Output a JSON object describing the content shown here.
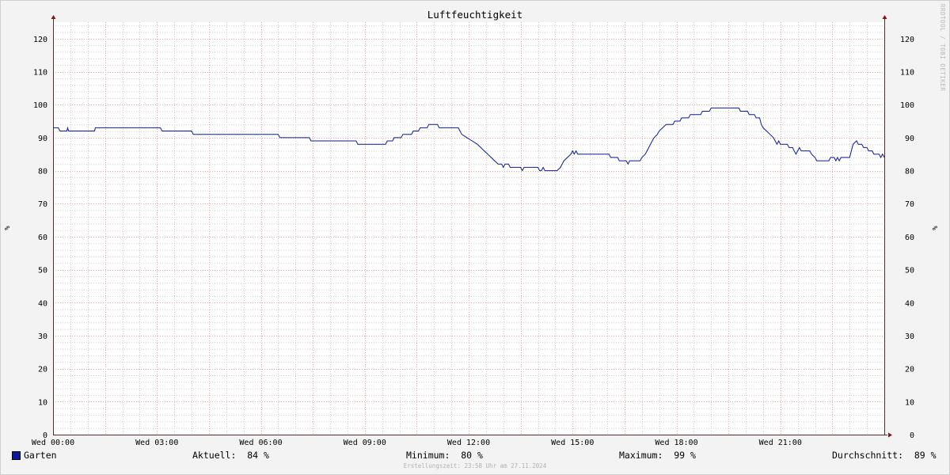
{
  "chart_data": {
    "type": "line",
    "title": "Luftfeuchtigkeit",
    "ylabel": "%",
    "ylim": [
      0,
      125
    ],
    "y_major_ticks": [
      0,
      10,
      20,
      30,
      40,
      50,
      60,
      70,
      80,
      90,
      100,
      110,
      120
    ],
    "x_range_hours": [
      0,
      24
    ],
    "x_tick_labels": [
      "Wed 00:00",
      "Wed 03:00",
      "Wed 06:00",
      "Wed 09:00",
      "Wed 12:00",
      "Wed 15:00",
      "Wed 18:00",
      "Wed 21:00"
    ],
    "grid": true,
    "series": [
      {
        "name": "Garten",
        "color": "#0a1a9a",
        "points": [
          [
            0.0,
            93
          ],
          [
            0.15,
            93
          ],
          [
            0.2,
            92
          ],
          [
            0.4,
            92
          ],
          [
            0.42,
            93
          ],
          [
            0.45,
            92
          ],
          [
            1.2,
            92
          ],
          [
            1.22,
            93
          ],
          [
            3.1,
            93
          ],
          [
            3.15,
            92
          ],
          [
            4.0,
            92
          ],
          [
            4.05,
            91
          ],
          [
            6.5,
            91
          ],
          [
            6.55,
            90
          ],
          [
            7.4,
            90
          ],
          [
            7.45,
            89
          ],
          [
            8.75,
            89
          ],
          [
            8.8,
            88
          ],
          [
            9.6,
            88
          ],
          [
            9.65,
            89
          ],
          [
            9.8,
            89
          ],
          [
            9.85,
            90
          ],
          [
            10.05,
            90
          ],
          [
            10.1,
            91
          ],
          [
            10.35,
            91
          ],
          [
            10.4,
            92
          ],
          [
            10.55,
            92
          ],
          [
            10.6,
            93
          ],
          [
            10.8,
            93
          ],
          [
            10.85,
            94
          ],
          [
            11.1,
            94
          ],
          [
            11.15,
            93
          ],
          [
            11.7,
            93
          ],
          [
            11.75,
            92
          ],
          [
            11.8,
            91
          ],
          [
            11.95,
            90
          ],
          [
            12.1,
            89
          ],
          [
            12.25,
            88
          ],
          [
            12.35,
            87
          ],
          [
            12.45,
            86
          ],
          [
            12.55,
            85
          ],
          [
            12.65,
            84
          ],
          [
            12.75,
            83
          ],
          [
            12.85,
            82
          ],
          [
            12.95,
            82
          ],
          [
            13.0,
            81
          ],
          [
            13.05,
            82
          ],
          [
            13.15,
            82
          ],
          [
            13.2,
            81
          ],
          [
            13.5,
            81
          ],
          [
            13.55,
            80
          ],
          [
            13.6,
            81
          ],
          [
            14.0,
            81
          ],
          [
            14.05,
            80
          ],
          [
            14.1,
            80
          ],
          [
            14.15,
            81
          ],
          [
            14.2,
            80
          ],
          [
            14.55,
            80
          ],
          [
            14.65,
            81
          ],
          [
            14.75,
            83
          ],
          [
            14.85,
            84
          ],
          [
            14.95,
            85
          ],
          [
            15.0,
            86
          ],
          [
            15.05,
            85
          ],
          [
            15.1,
            86
          ],
          [
            15.15,
            85
          ],
          [
            16.05,
            85
          ],
          [
            16.1,
            84
          ],
          [
            16.3,
            84
          ],
          [
            16.35,
            83
          ],
          [
            16.55,
            83
          ],
          [
            16.6,
            82
          ],
          [
            16.65,
            83
          ],
          [
            16.95,
            83
          ],
          [
            17.0,
            84
          ],
          [
            17.1,
            85
          ],
          [
            17.15,
            86
          ],
          [
            17.2,
            87
          ],
          [
            17.25,
            88
          ],
          [
            17.3,
            89
          ],
          [
            17.35,
            90
          ],
          [
            17.45,
            91
          ],
          [
            17.5,
            92
          ],
          [
            17.6,
            93
          ],
          [
            17.7,
            94
          ],
          [
            17.9,
            94
          ],
          [
            17.95,
            95
          ],
          [
            18.1,
            95
          ],
          [
            18.15,
            96
          ],
          [
            18.35,
            96
          ],
          [
            18.4,
            97
          ],
          [
            18.7,
            97
          ],
          [
            18.75,
            98
          ],
          [
            18.95,
            98
          ],
          [
            19.0,
            99
          ],
          [
            19.8,
            99
          ],
          [
            19.85,
            98
          ],
          [
            20.05,
            98
          ],
          [
            20.1,
            97
          ],
          [
            20.25,
            97
          ],
          [
            20.3,
            96
          ],
          [
            20.4,
            96
          ],
          [
            20.45,
            94
          ],
          [
            20.5,
            93
          ],
          [
            20.6,
            92
          ],
          [
            20.7,
            91
          ],
          [
            20.8,
            90
          ],
          [
            20.85,
            89
          ],
          [
            20.9,
            88
          ],
          [
            20.95,
            89
          ],
          [
            21.0,
            88
          ],
          [
            21.2,
            88
          ],
          [
            21.25,
            87
          ],
          [
            21.35,
            87
          ],
          [
            21.4,
            86
          ],
          [
            21.45,
            85
          ],
          [
            21.5,
            86
          ],
          [
            21.55,
            87
          ],
          [
            21.6,
            86
          ],
          [
            21.85,
            86
          ],
          [
            21.9,
            85
          ],
          [
            22.0,
            84
          ],
          [
            22.05,
            83
          ],
          [
            22.4,
            83
          ],
          [
            22.45,
            84
          ],
          [
            22.55,
            84
          ],
          [
            22.6,
            83
          ],
          [
            22.65,
            84
          ],
          [
            22.7,
            83
          ],
          [
            22.75,
            84
          ],
          [
            23.0,
            84
          ],
          [
            23.05,
            86
          ],
          [
            23.1,
            88
          ],
          [
            23.2,
            89
          ],
          [
            23.25,
            88
          ],
          [
            23.35,
            88
          ],
          [
            23.4,
            87
          ],
          [
            23.5,
            87
          ],
          [
            23.55,
            86
          ],
          [
            23.65,
            86
          ],
          [
            23.7,
            85
          ],
          [
            23.85,
            85
          ],
          [
            23.9,
            84
          ],
          [
            23.95,
            85
          ],
          [
            24.0,
            84
          ]
        ]
      }
    ]
  },
  "legend": {
    "series_name": "Garten",
    "current_label": "Aktuell:",
    "current_value": "84 %",
    "min_label": "Minimum:",
    "min_value": "80 %",
    "max_label": "Maximum:",
    "max_value": "99 %",
    "avg_label": "Durchschnitt:",
    "avg_value": "89 %"
  },
  "footer": "Erstellungszeit: 23:58 Uhr am 27.11.2024",
  "watermark": "RRDTOOL / TOBI OETIKER",
  "colors": {
    "background": "#f3f3f3",
    "plot_background": "#ffffff",
    "major_grid": "#e8a0a0",
    "minor_grid": "#cccccc",
    "axis": "#5a2a2a",
    "line": "#0a1a9a"
  }
}
